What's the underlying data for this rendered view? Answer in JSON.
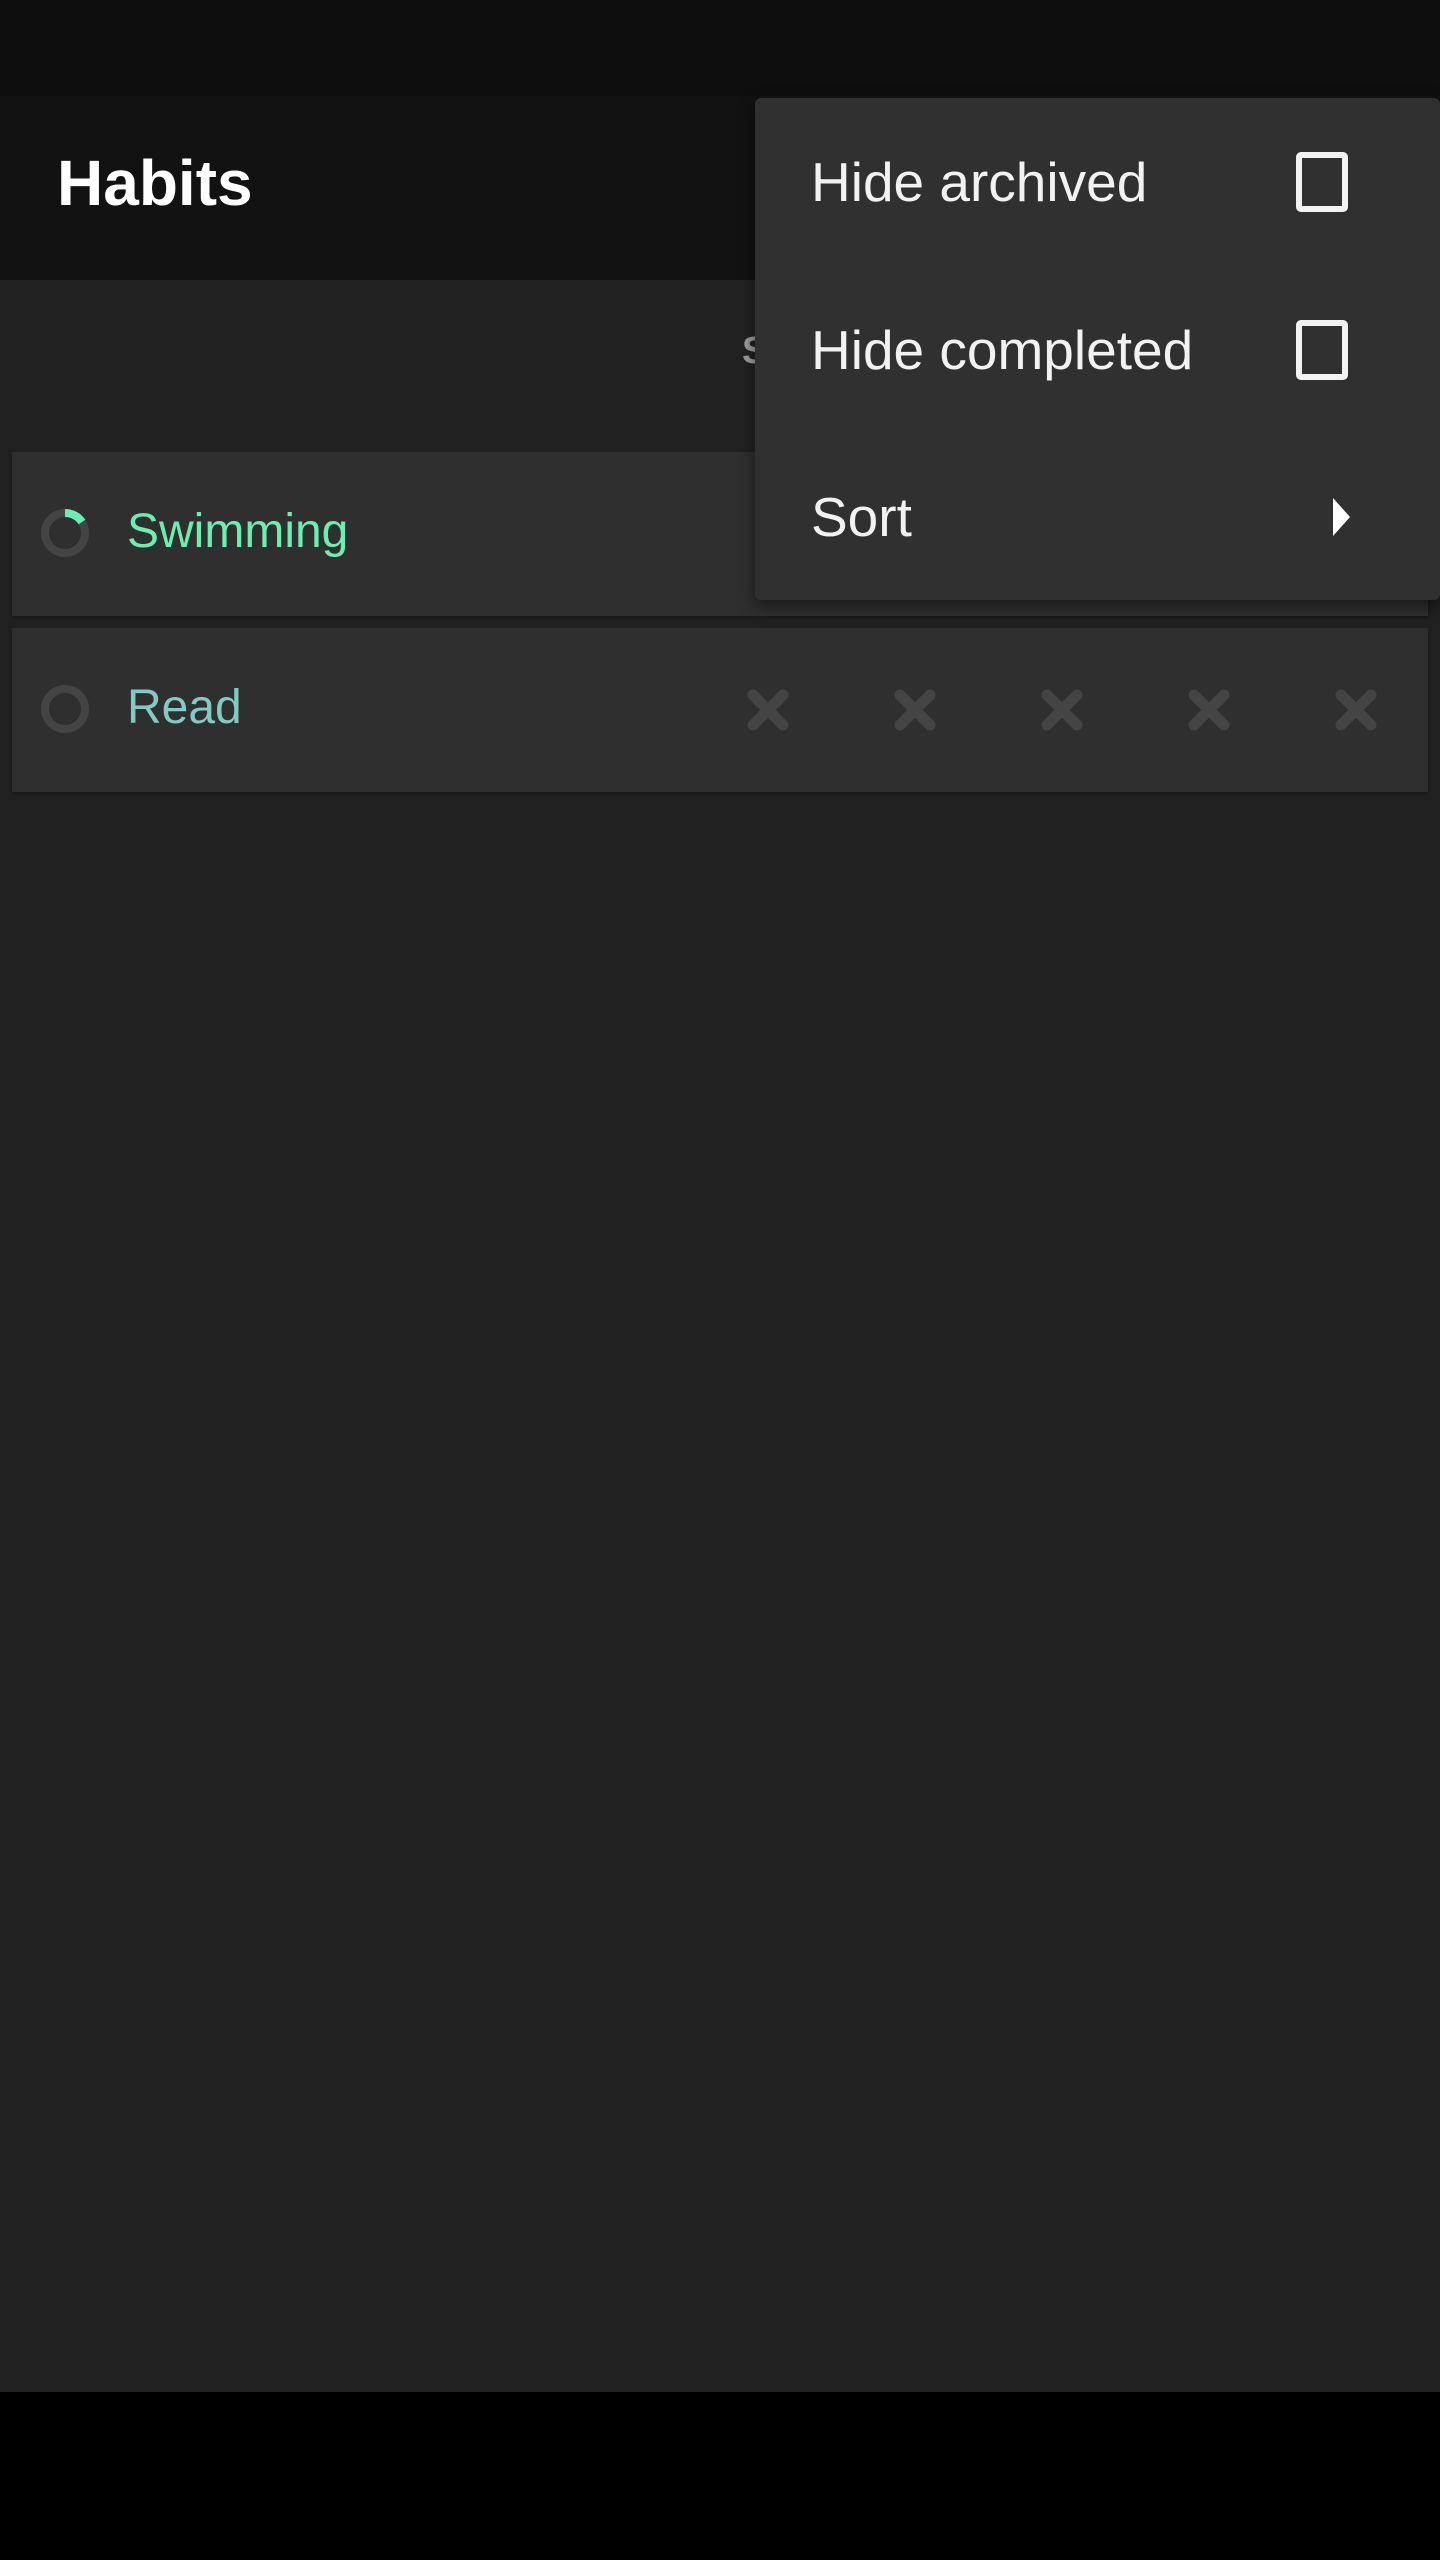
{
  "app_bar": {
    "title": "Habits"
  },
  "header": {
    "day_fragment": "S"
  },
  "habits": [
    {
      "name": "Swimming",
      "color": "#69f0ae",
      "progress": 0.15,
      "marks": []
    },
    {
      "name": "Read",
      "color": "#80cbc4",
      "progress": 0,
      "marks": [
        "x",
        "x",
        "x",
        "x",
        "x"
      ]
    }
  ],
  "menu": {
    "items": [
      {
        "label": "Hide archived",
        "type": "checkbox",
        "checked": false
      },
      {
        "label": "Hide completed",
        "type": "checkbox",
        "checked": false
      },
      {
        "label": "Sort",
        "type": "submenu",
        "icon": "chevron-right-icon"
      }
    ]
  }
}
